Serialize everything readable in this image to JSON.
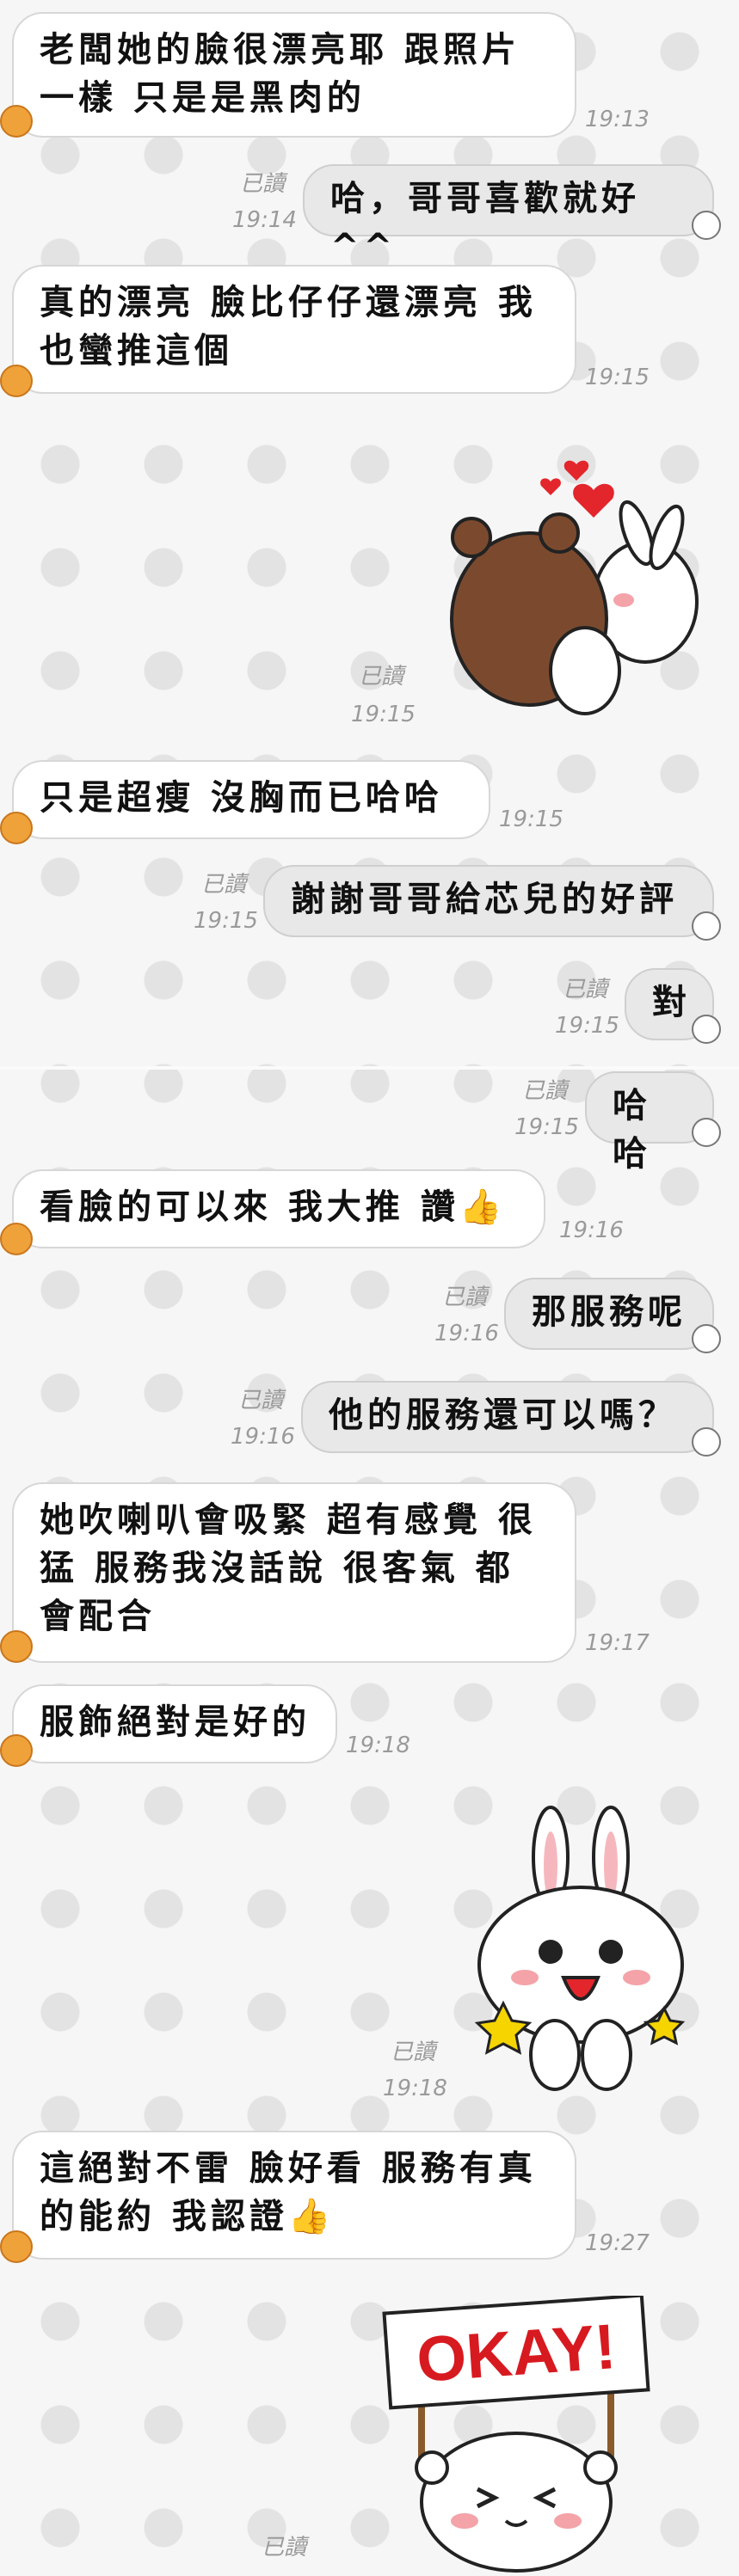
{
  "messages": [
    {
      "id": "m1",
      "dir": "in",
      "text": "老闆她的臉很漂亮耶 跟照片一樣 只是是黑肉的",
      "time": "19:13"
    },
    {
      "id": "m2",
      "dir": "out",
      "text": "哈，哥哥喜歡就好^^",
      "read": "已讀",
      "time": "19:14"
    },
    {
      "id": "m3",
      "dir": "in",
      "text": "真的漂亮 臉比仔仔還漂亮 我也蠻推這個",
      "time": "19:15"
    },
    {
      "id": "m4",
      "dir": "out-sticker",
      "sticker": "bear-hug-sticker",
      "read": "已讀",
      "time": "19:15"
    },
    {
      "id": "m5",
      "dir": "in",
      "text": "只是超瘦 沒胸而已哈哈",
      "time": "19:15"
    },
    {
      "id": "m6",
      "dir": "out",
      "text": "謝謝哥哥給芯兒的好評",
      "read": "已讀",
      "time": "19:15"
    },
    {
      "id": "m7",
      "dir": "out",
      "text": "對",
      "read": "已讀",
      "time": "19:15"
    },
    {
      "id": "m8",
      "dir": "out",
      "text": "哈哈",
      "read": "已讀",
      "time": "19:15"
    },
    {
      "id": "m9",
      "dir": "in",
      "text": "看臉的可以來 我大推 讚👍",
      "time": "19:16"
    },
    {
      "id": "m10",
      "dir": "out",
      "text": "那服務呢",
      "read": "已讀",
      "time": "19:16"
    },
    {
      "id": "m11",
      "dir": "out",
      "text": "他的服務還可以嗎？",
      "read": "已讀",
      "time": "19:16"
    },
    {
      "id": "m12",
      "dir": "in",
      "text": "她吹喇叭會吸緊 超有感覺 很猛 服務我沒話說 很客氣 都會配合",
      "time": "19:17"
    },
    {
      "id": "m13",
      "dir": "in",
      "text": "服飾絕對是好的",
      "time": "19:18"
    },
    {
      "id": "m14",
      "dir": "out-sticker",
      "sticker": "bunny-cheer-sticker",
      "read": "已讀",
      "time": "19:18"
    },
    {
      "id": "m15",
      "dir": "in",
      "text": "這絕對不雷 臉好看 服務有真的能約 我認證👍",
      "time": "19:27"
    },
    {
      "id": "m16",
      "dir": "out-sticker",
      "sticker": "okay-sign-sticker",
      "sign": "OKAY!",
      "read": "已讀"
    }
  ],
  "colors": {
    "in_bubble": "#ffffff",
    "out_bubble": "#e8e8e8",
    "time": "#9a9a9a",
    "okay_sign": "#d71a20"
  }
}
